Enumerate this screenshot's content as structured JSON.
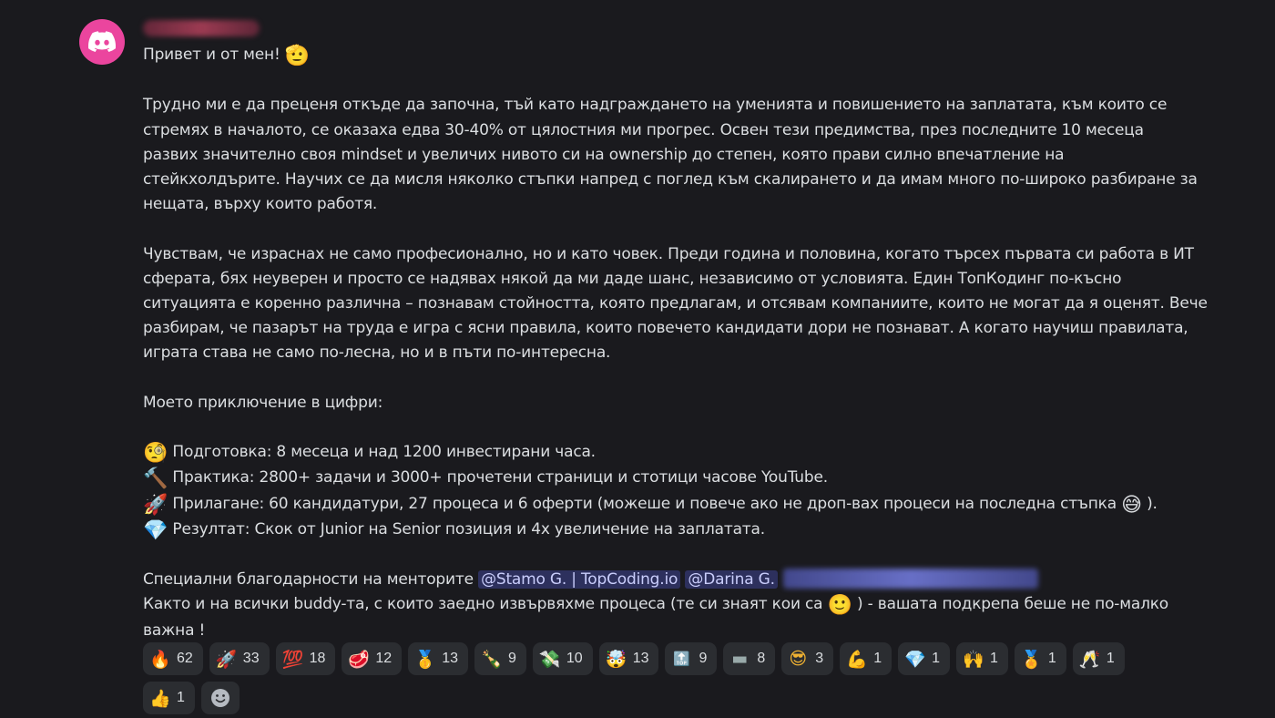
{
  "message": {
    "greeting": "Привет и от мен!",
    "greeting_emoji": "🫡",
    "para1": [
      "Трудно ми е да преценя откъде да започна, тъй като надграждането на уменията и повишението на заплатата, към които се",
      "стремях в началото, се оказаха едва 30-40% от цялостния ми прогрес. Освен тези предимства, през последните 10 месеца",
      "развих значително своя mindset и увеличих нивото си на ownership до степен, която прави силно впечатление на",
      "стейкхолдърите. Научих се да мисля няколко стъпки напред с поглед към скалирането и да имам много по-широко разбиране за",
      "нещата, върху които работя."
    ],
    "para2": [
      "Чувствам, че израснах не само професионално, но и като човек. Преди година и половина, когато търсех първата си работа в ИТ",
      "сферата, бях неуверен и просто се надявах някой да ми даде шанс, независимо от условията. Един ТопКодинг по-късно",
      "ситуацията е коренно различна – познавам стойността, която предлагам, и отсявам компаниите, които не могат да я оценят. Вече",
      "разбирам, че пазарът на труда е игра с ясни правила, които повечето кандидати дори не познават. А когато научиш правилата,",
      "играта става не само по-лесна, но и в пъти по-интересна."
    ],
    "numbers_heading": "Моето приключение в цифри:",
    "list": [
      {
        "emoji": "🧐",
        "text": "Подготовка: 8 месеца и над 1200 инвестирани часа."
      },
      {
        "emoji": "🔨",
        "text": "Практика: 2800+ задачи и 3000+ прочетени страници и стотици часове YouTube."
      },
      {
        "emoji": "🚀",
        "text": "Прилагане: 60 кандидатури, 27 процеса и 6 оферти (можеше и повече ако не дроп-вах процеси на последна стъпка"
      },
      {
        "emoji": "💎",
        "text": "Резултат: Скок от Junior на Senior позиция и 4x увеличение на заплатата."
      }
    ],
    "list_tail_emoji": "😅",
    "list_tail_text": ").",
    "thanks_prefix": "Специални благодарности на менторите",
    "mention1": "@Stamo G. | TopCoding.io",
    "mention2": "@Darina G.",
    "buddy_text": "Както и на всички buddy-та,  с които заедно извървяхме процеса (те си знаят кои са",
    "buddy_emoji": "🙂",
    "buddy_tail": ") - вашата подкрепа беше не по-малко",
    "last_line": "важна !"
  },
  "reactions": [
    {
      "icon": "🔥",
      "count": "62"
    },
    {
      "icon": "🚀",
      "count": "33"
    },
    {
      "icon": "💯",
      "count": "18"
    },
    {
      "icon": "🥩",
      "count": "12"
    },
    {
      "icon": "🥇",
      "count": "13"
    },
    {
      "icon": "🍾",
      "count": "9"
    },
    {
      "icon": "💸",
      "count": "10"
    },
    {
      "icon": "🤯",
      "count": "13"
    },
    {
      "icon": "🔝",
      "count": "9"
    },
    {
      "icon": "▬",
      "count": "8"
    },
    {
      "icon": "😎",
      "count": "3"
    },
    {
      "icon": "💪",
      "count": "1"
    },
    {
      "icon": "💎",
      "count": "1"
    },
    {
      "icon": "🙌",
      "count": "1"
    },
    {
      "icon": "🏅",
      "count": "1"
    },
    {
      "icon": "🥂",
      "count": "1"
    },
    {
      "icon": "👍",
      "count": "1"
    }
  ],
  "colors": {
    "background": "#1a1a1e",
    "avatar": "#eb459e",
    "mention_bg": "#3c4270",
    "reaction_bg": "#2b2d31"
  }
}
